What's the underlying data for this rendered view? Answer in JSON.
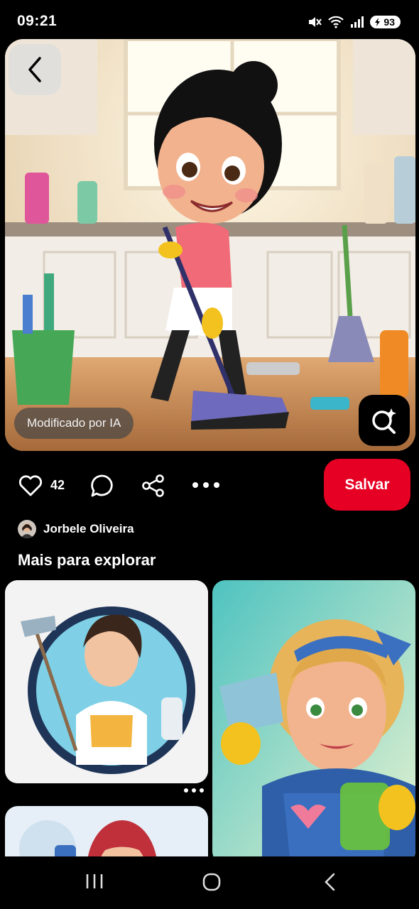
{
  "status_bar": {
    "time": "09:21",
    "battery": "93"
  },
  "pin": {
    "ai_label": "Modificado por IA",
    "likes": "42",
    "save_label": "Salvar",
    "author": "Jorbele Oliveira"
  },
  "explore": {
    "title": "Mais para explorar"
  },
  "icons": {
    "back": "chevron-left-icon",
    "lens": "visual-search-icon",
    "like": "heart-icon",
    "comment": "comment-icon",
    "share": "share-icon",
    "more": "more-icon"
  },
  "colors": {
    "accent": "#e60023",
    "background": "#000000"
  }
}
